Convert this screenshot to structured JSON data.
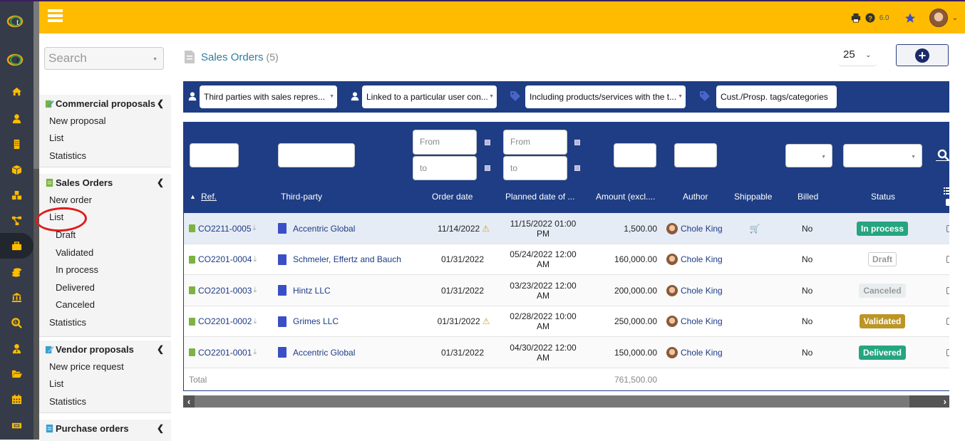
{
  "topbar": {
    "version": "6.0",
    "colors": {
      "topbar": "#ffbb00",
      "rail": "#353b48",
      "navy": "#1e3d84",
      "link": "#1d3b86"
    }
  },
  "rail": {
    "icons": [
      "logo-icon",
      "home-icon",
      "user-icon",
      "building-icon",
      "box-icon",
      "cubes-icon",
      "project-icon",
      "briefcase-icon",
      "coins-icon",
      "bank-icon",
      "search-dollar-icon",
      "user-tie-icon",
      "folder-open-icon",
      "calendar-icon",
      "ticket-icon"
    ],
    "active": "briefcase-icon"
  },
  "menu": {
    "search_placeholder": "Search",
    "sections": [
      {
        "title": "Commercial proposals",
        "items": [
          {
            "label": "New proposal"
          },
          {
            "label": "List"
          },
          {
            "label": "Statistics"
          }
        ]
      },
      {
        "title": "Sales Orders",
        "items": [
          {
            "label": "New order"
          },
          {
            "label": "List"
          },
          {
            "label": "Draft"
          },
          {
            "label": "Validated"
          },
          {
            "label": "In process"
          },
          {
            "label": "Delivered"
          },
          {
            "label": "Canceled"
          },
          {
            "label": "Statistics"
          }
        ]
      },
      {
        "title": "Vendor proposals",
        "items": [
          {
            "label": "New price request"
          },
          {
            "label": "List"
          },
          {
            "label": "Statistics"
          }
        ]
      },
      {
        "title": "Purchase orders",
        "items": []
      }
    ]
  },
  "page": {
    "title": "Sales Orders",
    "count": "(5)",
    "limit": "25"
  },
  "filters": {
    "sales_rep": "Third parties with sales repres...",
    "linked_user": "Linked to a particular user con...",
    "products": "Including products/services with the t...",
    "tags": "Cust./Prosp. tags/categories"
  },
  "table": {
    "filter_placeholders": {
      "from": "From",
      "to": "to"
    },
    "headers": {
      "ref": "Ref.",
      "thirdparty": "Third-party",
      "order_date": "Order date",
      "planned_date": "Planned date of ...",
      "amount": "Amount (excl....",
      "author": "Author",
      "shippable": "Shippable",
      "billed": "Billed",
      "status": "Status"
    },
    "rows": [
      {
        "ref": "CO2211-0005",
        "thirdparty": "Accentric Global",
        "order_date": "11/14/2022",
        "warning": "⚠",
        "planned_l1": "11/15/2022 01:00",
        "planned_l2": "PM",
        "amount": "1,500.00",
        "author": "Chole King",
        "shippable": "🛒",
        "billed": "No",
        "status": "In process"
      },
      {
        "ref": "CO2201-0004",
        "thirdparty": "Schmeler, Effertz and Bauch",
        "order_date": "01/31/2022",
        "warning": "",
        "planned_l1": "05/24/2022 12:00",
        "planned_l2": "AM",
        "amount": "160,000.00",
        "author": "Chole King",
        "shippable": "",
        "billed": "No",
        "status": "Draft"
      },
      {
        "ref": "CO2201-0003",
        "thirdparty": "Hintz LLC",
        "order_date": "01/31/2022",
        "warning": "",
        "planned_l1": "03/23/2022 12:00",
        "planned_l2": "AM",
        "amount": "200,000.00",
        "author": "Chole King",
        "shippable": "",
        "billed": "No",
        "status": "Canceled"
      },
      {
        "ref": "CO2201-0002",
        "thirdparty": "Grimes LLC",
        "order_date": "01/31/2022",
        "warning": "⚠",
        "planned_l1": "02/28/2022 10:00",
        "planned_l2": "AM",
        "amount": "250,000.00",
        "author": "Chole King",
        "shippable": "",
        "billed": "No",
        "status": "Validated"
      },
      {
        "ref": "CO2201-0001",
        "thirdparty": "Accentric Global",
        "order_date": "01/31/2022",
        "warning": "",
        "planned_l1": "04/30/2022 12:00",
        "planned_l2": "AM",
        "amount": "150,000.00",
        "author": "Chole King",
        "shippable": "",
        "billed": "No",
        "status": "Delivered"
      }
    ],
    "total_label": "Total",
    "total_amount": "761,500.00",
    "status_colors": {
      "In process": {
        "bg": "#25a580",
        "fg": "#ffffff",
        "border": "#25a580"
      },
      "Draft": {
        "bg": "#ffffff",
        "fg": "#999999",
        "border": "#cccccc"
      },
      "Canceled": {
        "bg": "#e8eeef",
        "fg": "#999999",
        "border": "#e8eeef"
      },
      "Validated": {
        "bg": "#bc9526",
        "fg": "#ffffff",
        "border": "#bc9526"
      },
      "Delivered": {
        "bg": "#25a580",
        "fg": "#ffffff",
        "border": "#25a580"
      }
    }
  }
}
